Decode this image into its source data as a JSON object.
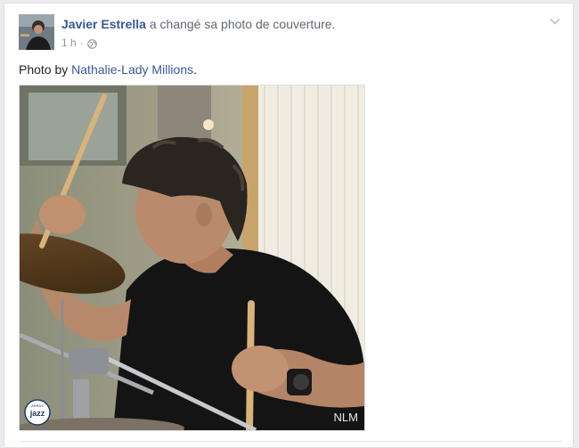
{
  "post": {
    "author_name": "Javier Estrella",
    "action_text": " a changé sa photo de couverture.",
    "timestamp": "1 h",
    "separator": "·",
    "privacy_icon": "globe-icon",
    "menu_icon": "chevron-down-icon",
    "caption_prefix": "Photo by ",
    "caption_link": "Nathalie-Lady Millions",
    "caption_suffix": ".",
    "photo": {
      "logo_top": "ARRAS",
      "logo_main": "jazz",
      "watermark": "NLM"
    }
  },
  "colors": {
    "link": "#365899",
    "muted": "#90949c",
    "text": "#1d2129",
    "background": "#e9ebee"
  }
}
